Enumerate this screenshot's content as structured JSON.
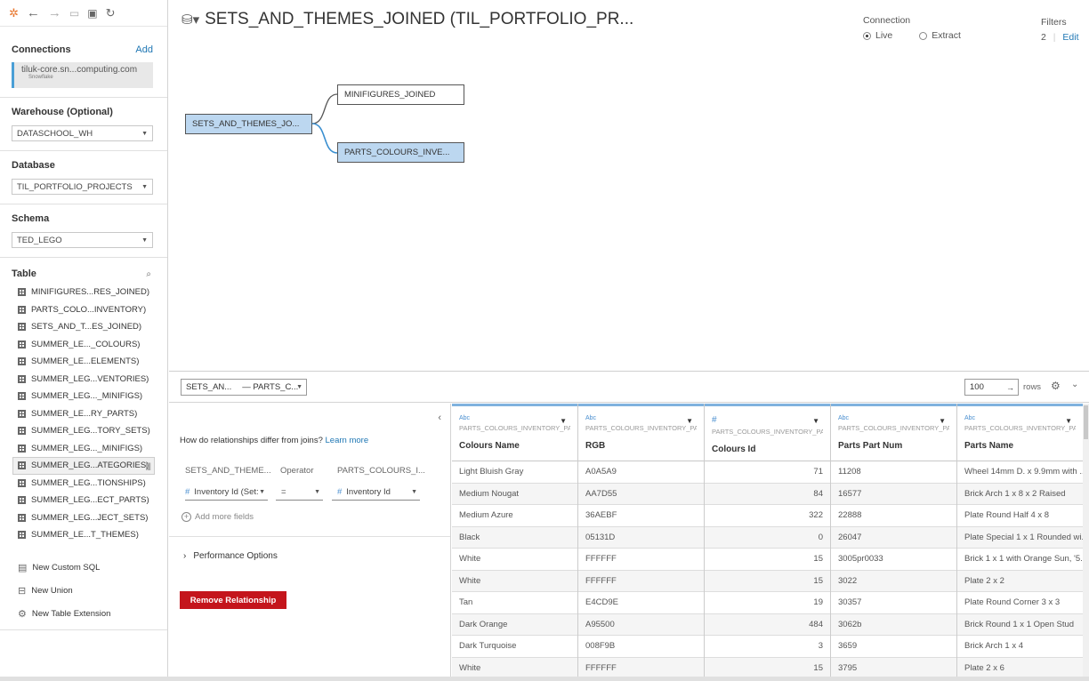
{
  "sidebar": {
    "connections_title": "Connections",
    "add_label": "Add",
    "connection_name": "tiluk-core.sn...computing.com",
    "connection_type": "Snowflake",
    "warehouse_title": "Warehouse (Optional)",
    "warehouse_value": "DATASCHOOL_WH",
    "database_title": "Database",
    "database_value": "TIL_PORTFOLIO_PROJECTS",
    "schema_title": "Schema",
    "schema_value": "TED_LEGO",
    "table_title": "Table",
    "tables": [
      "MINIFIGURES...RES_JOINED)",
      "PARTS_COLO...INVENTORY)",
      "SETS_AND_T...ES_JOINED)",
      "SUMMER_LE..._COLOURS)",
      "SUMMER_LE...ELEMENTS)",
      "SUMMER_LEG...VENTORIES)",
      "SUMMER_LEG..._MINIFIGS)",
      "SUMMER_LE...RY_PARTS)",
      "SUMMER_LEG...TORY_SETS)",
      "SUMMER_LEG..._MINIFIGS)",
      "SUMMER_LEG...ATEGORIES)",
      "SUMMER_LEG...TIONSHIPS)",
      "SUMMER_LEG...ECT_PARTS)",
      "SUMMER_LEG...JECT_SETS)",
      "SUMMER_LE...T_THEMES)"
    ],
    "extras": [
      "New Custom SQL",
      "New Union",
      "New Table Extension"
    ]
  },
  "header": {
    "title": "SETS_AND_THEMES_JOINED (TIL_PORTFOLIO_PR...",
    "connection_label": "Connection",
    "live_label": "Live",
    "extract_label": "Extract",
    "filters_label": "Filters",
    "filters_count": "2",
    "filters_edit": "Edit"
  },
  "canvas": {
    "root_node": "SETS_AND_THEMES_JO...",
    "node_1": "MINIFIGURES_JOINED",
    "node_2": "PARTS_COLOURS_INVE..."
  },
  "grid_toolbar": {
    "relationship_left": "SETS_AN...",
    "relationship_right": "— PARTS_C...",
    "rows_value": "100",
    "rows_label": "rows"
  },
  "relationship_panel": {
    "question": "How do relationships differ from joins?",
    "learn_more": "Learn more",
    "left_table": "SETS_AND_THEME...",
    "operator_label": "Operator",
    "right_table": "PARTS_COLOURS_I...",
    "left_field": "Inventory Id (Set:",
    "operator_value": "=",
    "right_field": "Inventory Id",
    "add_more": "Add more fields",
    "performance_options": "Performance Options",
    "remove_button": "Remove Relationship"
  },
  "grid": {
    "columns": [
      {
        "type": "Abc",
        "source": "PARTS_COLOURS_INVENTORY_PARTS",
        "name": "Colours Name",
        "align": "left"
      },
      {
        "type": "Abc",
        "source": "PARTS_COLOURS_INVENTORY_PARTS",
        "name": "RGB",
        "align": "left"
      },
      {
        "type": "#",
        "source": "PARTS_COLOURS_INVENTORY_PARTS",
        "name": "Colours Id",
        "align": "right"
      },
      {
        "type": "Abc",
        "source": "PARTS_COLOURS_INVENTORY_PARTS",
        "name": "Parts Part Num",
        "align": "left"
      },
      {
        "type": "Abc",
        "source": "PARTS_COLOURS_INVENTORY_PARTS",
        "name": "Parts Name",
        "align": "left"
      }
    ],
    "rows": [
      [
        "Light Bluish Gray",
        "A0A5A9",
        "71",
        "11208",
        "Wheel 14mm D. x 9.9mm with ..."
      ],
      [
        "Medium Nougat",
        "AA7D55",
        "84",
        "16577",
        "Brick Arch 1 x 8 x 2 Raised"
      ],
      [
        "Medium Azure",
        "36AEBF",
        "322",
        "22888",
        "Plate Round Half 4 x 8"
      ],
      [
        "Black",
        "05131D",
        "0",
        "26047",
        "Plate Special 1 x 1 Rounded wi..."
      ],
      [
        "White",
        "FFFFFF",
        "15",
        "3005pr0033",
        "Brick 1 x 1 with Orange Sun, '5..."
      ],
      [
        "White",
        "FFFFFF",
        "15",
        "3022",
        "Plate 2 x 2"
      ],
      [
        "Tan",
        "E4CD9E",
        "19",
        "30357",
        "Plate Round Corner 3 x 3"
      ],
      [
        "Dark Orange",
        "A95500",
        "484",
        "3062b",
        "Brick Round 1 x 1 Open Stud"
      ],
      [
        "Dark Turquoise",
        "008F9B",
        "3",
        "3659",
        "Brick Arch 1 x 4"
      ],
      [
        "White",
        "FFFFFF",
        "15",
        "3795",
        "Plate 2 x 6"
      ]
    ]
  },
  "colors": {
    "accent_blue": "#1f77b4",
    "selected_node": "#bcd7f0",
    "remove_red": "#c4151c"
  }
}
